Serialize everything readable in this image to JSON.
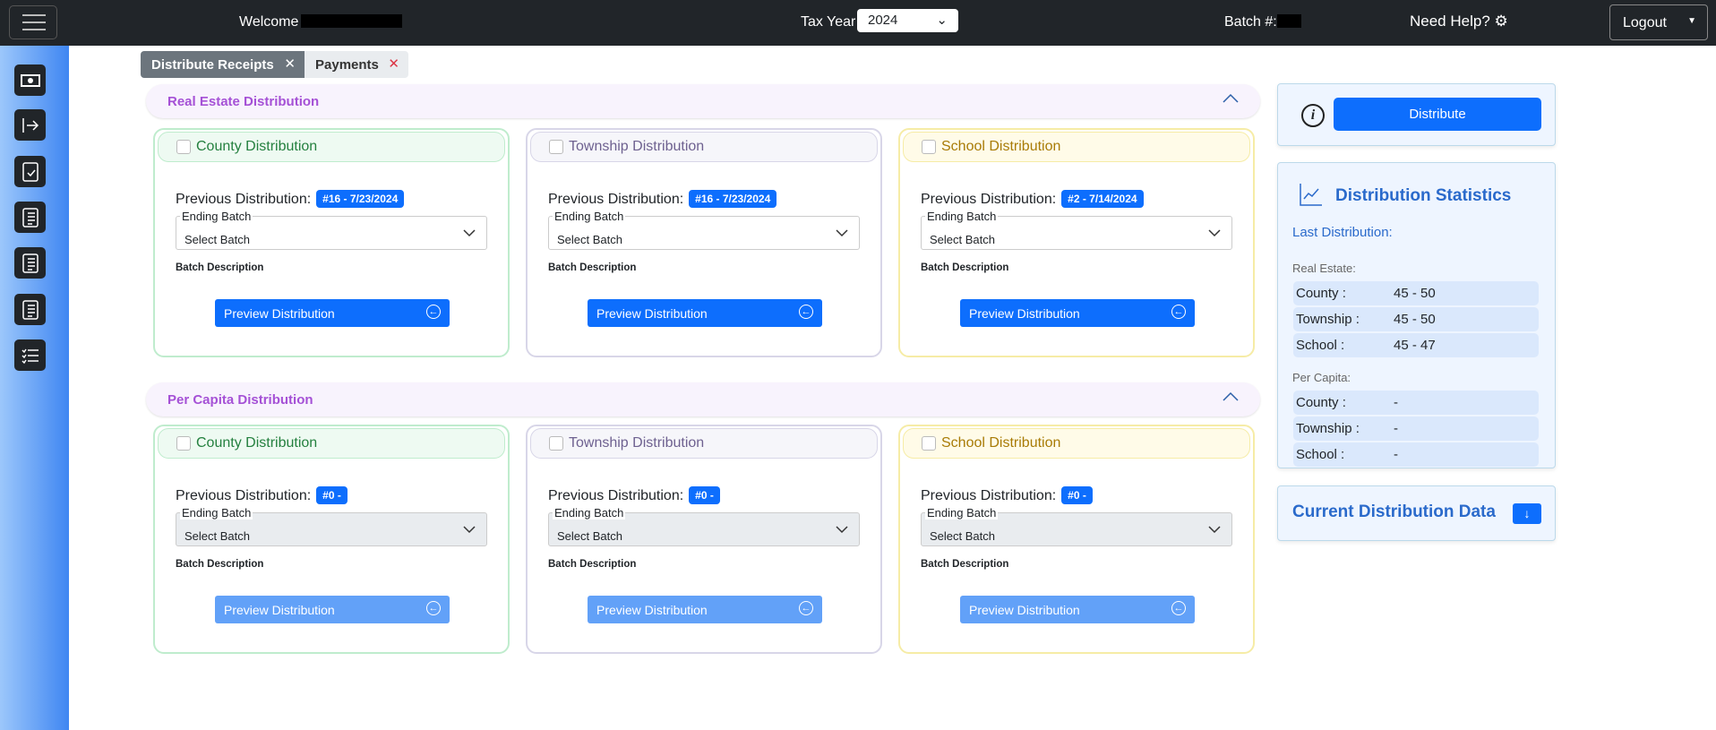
{
  "topbar": {
    "welcome": "Welcome",
    "tax_year_label": "Tax Year",
    "tax_year": "2024",
    "batch_label": "Batch #:",
    "help": "Need Help?",
    "logout": "Logout"
  },
  "tabs": [
    {
      "label": "Distribute Receipts"
    },
    {
      "label": "Payments"
    }
  ],
  "sections": [
    {
      "title": "Real Estate Distribution",
      "cards": [
        {
          "title": "County Distribution",
          "prev_label": "Previous Distribution:",
          "prev_value": "#16 - 7/23/2024",
          "select_label": "Ending Batch",
          "select_value": "Select Batch",
          "desc_label": "Batch Description",
          "button": "Preview Distribution",
          "disabled": false
        },
        {
          "title": "Township Distribution",
          "prev_label": "Previous Distribution:",
          "prev_value": "#16 - 7/23/2024",
          "select_label": "Ending Batch",
          "select_value": "Select Batch",
          "desc_label": "Batch Description",
          "button": "Preview Distribution",
          "disabled": false
        },
        {
          "title": "School Distribution",
          "prev_label": "Previous Distribution:",
          "prev_value": "#2 - 7/14/2024",
          "select_label": "Ending Batch",
          "select_value": "Select Batch",
          "desc_label": "Batch Description",
          "button": "Preview Distribution",
          "disabled": false
        }
      ]
    },
    {
      "title": "Per Capita Distribution",
      "cards": [
        {
          "title": "County Distribution",
          "prev_label": "Previous Distribution:",
          "prev_value": "#0 -",
          "select_label": "Ending Batch",
          "select_value": "Select Batch",
          "desc_label": "Batch Description",
          "button": "Preview Distribution",
          "disabled": true
        },
        {
          "title": "Township Distribution",
          "prev_label": "Previous Distribution:",
          "prev_value": "#0 -",
          "select_label": "Ending Batch",
          "select_value": "Select Batch",
          "desc_label": "Batch Description",
          "button": "Preview Distribution",
          "disabled": true
        },
        {
          "title": "School Distribution",
          "prev_label": "Previous Distribution:",
          "prev_value": "#0 -",
          "select_label": "Ending Batch",
          "select_value": "Select Batch",
          "desc_label": "Batch Description",
          "button": "Preview Distribution",
          "disabled": true
        }
      ]
    }
  ],
  "themes": [
    {
      "border": "#bfeccd",
      "bg": "#eefaf2",
      "text": "#24803f"
    },
    {
      "border": "#d8d6e8",
      "bg": "#f6f6fa",
      "text": "#6e6190"
    },
    {
      "border": "#f6eca6",
      "bg": "#fffbe8",
      "text": "#a87b06"
    }
  ],
  "right": {
    "distribute": "Distribute",
    "stats_title": "Distribution Statistics",
    "last": "Last Distribution:",
    "groups": [
      {
        "label": "Real Estate:",
        "rows": [
          {
            "k": "County :",
            "v": "45 - 50"
          },
          {
            "k": "Township :",
            "v": "45 - 50"
          },
          {
            "k": "School :",
            "v": "45 - 47"
          }
        ]
      },
      {
        "label": "Per Capita:",
        "rows": [
          {
            "k": "County :",
            "v": "-"
          },
          {
            "k": "Township :",
            "v": "-"
          },
          {
            "k": "School :",
            "v": "-"
          }
        ]
      }
    ],
    "current": "Current Distribution Data"
  },
  "colors": {
    "primary": "#0d6efd",
    "section_title": "#a551d6",
    "stats_title": "#2a6acb"
  }
}
